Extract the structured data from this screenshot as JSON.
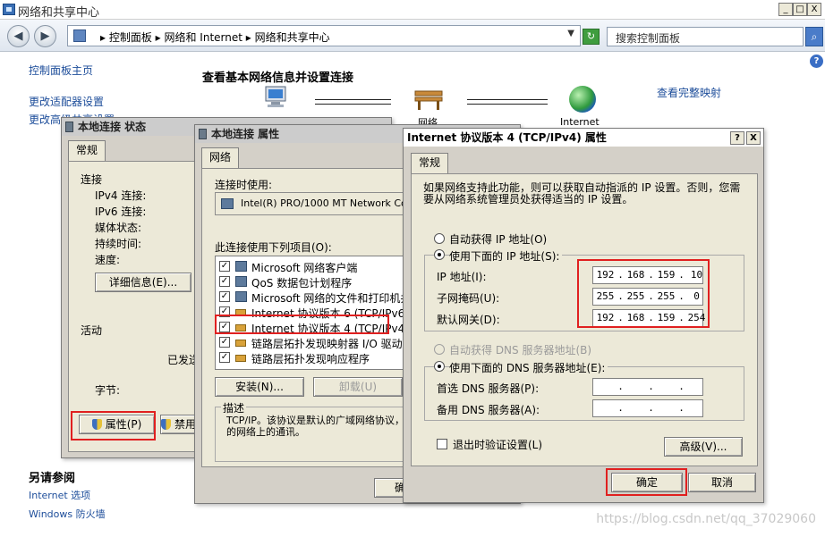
{
  "window": {
    "title": "网络和共享中心",
    "min": "_",
    "max": "□",
    "close": "X"
  },
  "addressbar": {
    "back": "◀",
    "forward": "▶",
    "breadcrumb": "▸ 控制面板 ▸ 网络和 Internet ▸ 网络和共享中心",
    "dropdown": "▼",
    "refresh": "↻",
    "search_placeholder": "搜索控制面板",
    "search_button": "⌕"
  },
  "help": "?",
  "sidebar": {
    "links": [
      "控制面板主页",
      "更改适配器设置",
      "更改高级共享设置"
    ],
    "see_also_heading": "另请参阅",
    "see_also": [
      "Internet 选项",
      "Windows 防火墙"
    ]
  },
  "main": {
    "heading": "查看基本网络信息并设置连接",
    "view_full_map": "查看完整映射",
    "network_label": "网络",
    "internet_label": "Internet"
  },
  "status_dialog": {
    "title": "本地连接 状态",
    "tab": "常规",
    "connection_heading": "连接",
    "rows": [
      "IPv4 连接:",
      "IPv6 连接:",
      "媒体状态:",
      "持续时间:",
      "速度:"
    ],
    "details_button": "详细信息(E)...",
    "activity_heading": "活动",
    "sent_label": "已发送",
    "bytes_label": "字节:",
    "properties_button": "属性(P)",
    "disable_button": "禁用(D)"
  },
  "props_dialog": {
    "title": "本地连接 属性",
    "tab": "网络",
    "connect_using": "连接时使用:",
    "adapter": "Intel(R) PRO/1000 MT Network Connection",
    "items_label": "此连接使用下列项目(O):",
    "items": [
      "Microsoft 网络客户端",
      "QoS 数据包计划程序",
      "Microsoft 网络的文件和打印机共享",
      "Internet 协议版本 6 (TCP/IPv6)",
      "Internet 协议版本 4 (TCP/IPv4)",
      "链路层拓扑发现映射器 I/O 驱动程序",
      "链路层拓扑发现响应程序"
    ],
    "install_button": "安装(N)...",
    "uninstall_button": "卸载(U)",
    "desc_heading": "描述",
    "desc_text": "TCP/IP。该协议是默认的广域网络协议，它提供在不同的相互连接的网络上的通讯。",
    "ok_button": "确定"
  },
  "ipv4_dialog": {
    "title": "Internet 协议版本 4 (TCP/IPv4) 属性",
    "help": "?",
    "close": "X",
    "tab": "常规",
    "intro": "如果网络支持此功能，则可以获取自动指派的 IP 设置。否则，您需要从网络系统管理员处获得适当的 IP 设置。",
    "auto_ip": "自动获得 IP 地址(O)",
    "manual_ip": "使用下面的 IP 地址(S):",
    "ip_label": "IP 地址(I):",
    "mask_label": "子网掩码(U):",
    "gateway_label": "默认网关(D):",
    "ip": [
      "192",
      "168",
      "159",
      "10"
    ],
    "mask": [
      "255",
      "255",
      "255",
      "0"
    ],
    "gateway": [
      "192",
      "168",
      "159",
      "254"
    ],
    "auto_dns": "自动获得 DNS 服务器地址(B)",
    "manual_dns": "使用下面的 DNS 服务器地址(E):",
    "pref_dns_label": "首选 DNS 服务器(P):",
    "alt_dns_label": "备用 DNS 服务器(A):",
    "validate_label": "退出时验证设置(L)",
    "advanced_button": "高级(V)...",
    "ok_button": "确定",
    "cancel_button": "取消"
  },
  "watermark": "https://blog.csdn.net/qq_37029060"
}
